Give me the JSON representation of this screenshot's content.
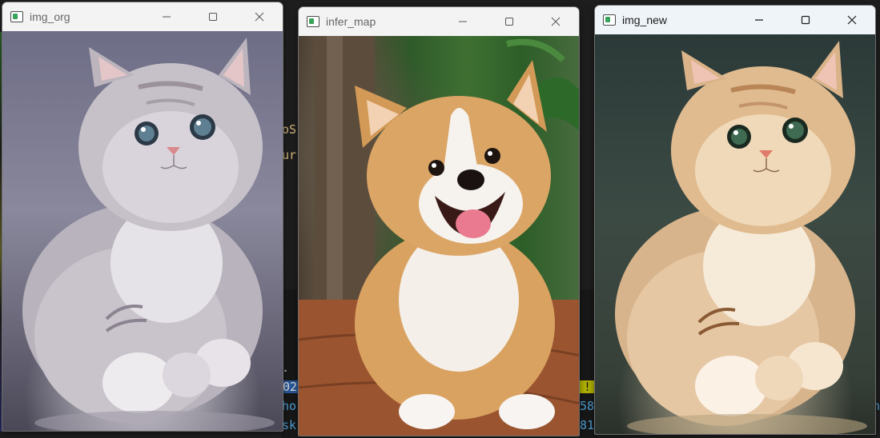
{
  "windows": [
    {
      "title": "img_org",
      "active": false,
      "image_subject": "grey kitten"
    },
    {
      "title": "infer_map",
      "active": false,
      "image_subject": "corgi puppy"
    },
    {
      "title": "img_new",
      "active": true,
      "image_subject": "warm-toned kitten"
    }
  ],
  "window_controls": {
    "minimize": "minimize-icon",
    "maximize": "maximize-icon",
    "close": "close-icon"
  },
  "background_text": {
    "frag_os": "oS",
    "frag_ur": "ur",
    "frag_dot": ".",
    "frag_02": "02",
    "frag_ho": "ho",
    "frag_sk": "sk",
    "frag_excl": "!",
    "frag_58": "58",
    "frag_81": "81",
    "frag_h": "h"
  },
  "colors": {
    "titlebar_inactive": "#f3f3f3",
    "titlebar_active": "#eff4f9",
    "terminal_bg": "#1e1e1e",
    "highlight_blue": "#2a5a9a",
    "highlight_yellow": "#b5b500"
  }
}
